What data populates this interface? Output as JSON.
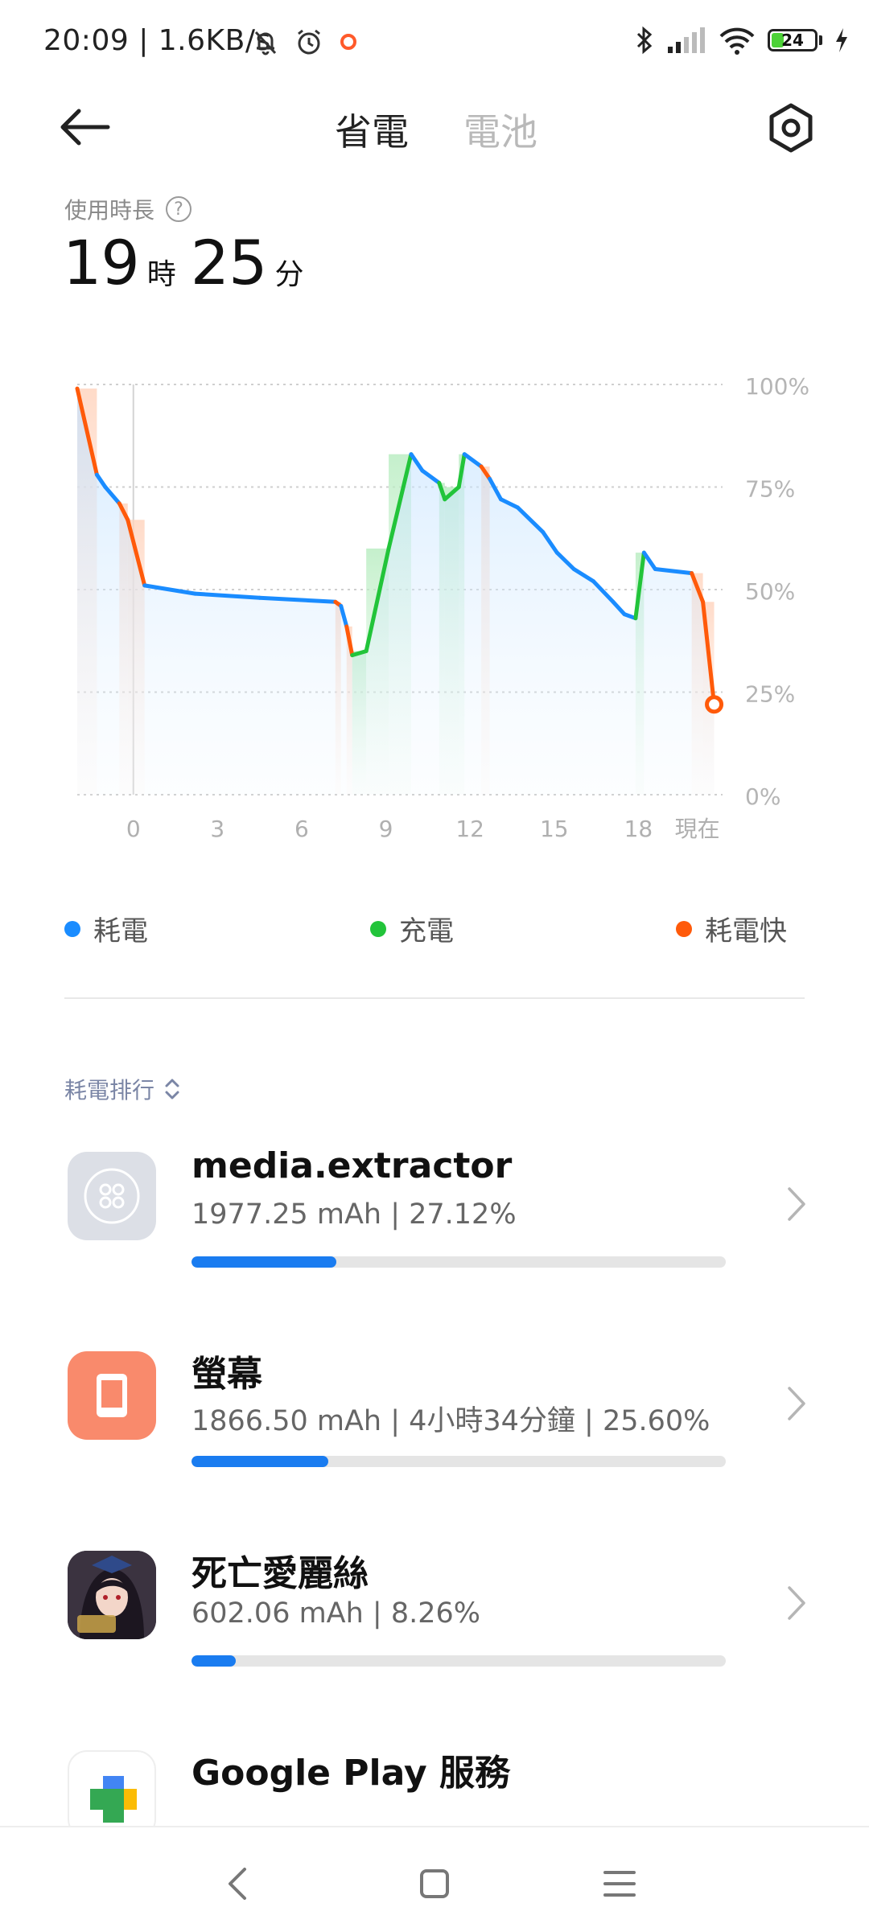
{
  "status_bar": {
    "time": "20:09 | 1.6KB/s",
    "battery_level": "24",
    "battery_color": "#4cd137"
  },
  "header": {
    "tab_power_saving": "省電",
    "tab_battery": "電池"
  },
  "usage": {
    "label": "使用時長",
    "hours": "19",
    "hours_unit": "時",
    "minutes": "25",
    "minutes_unit": "分"
  },
  "chart_data": {
    "type": "line",
    "y_ticks": [
      "100%",
      "75%",
      "50%",
      "25%",
      "0%"
    ],
    "x_ticks": [
      "0",
      "3",
      "6",
      "9",
      "12",
      "15",
      "18",
      "現在"
    ],
    "ylim": [
      0,
      100
    ],
    "xlim": [
      -2,
      21
    ],
    "points": [
      {
        "x": -2.0,
        "y": 99,
        "s": "fast"
      },
      {
        "x": -1.3,
        "y": 78,
        "s": "normal"
      },
      {
        "x": -1.0,
        "y": 75,
        "s": "normal"
      },
      {
        "x": -0.5,
        "y": 71,
        "s": "fast"
      },
      {
        "x": -0.2,
        "y": 67,
        "s": "fast"
      },
      {
        "x": 0.4,
        "y": 51,
        "s": "normal"
      },
      {
        "x": 2.2,
        "y": 49,
        "s": "normal"
      },
      {
        "x": 4.5,
        "y": 48,
        "s": "normal"
      },
      {
        "x": 7.2,
        "y": 47,
        "s": "fast"
      },
      {
        "x": 7.4,
        "y": 46,
        "s": "normal"
      },
      {
        "x": 7.6,
        "y": 41,
        "s": "fast"
      },
      {
        "x": 7.8,
        "y": 34,
        "s": "charging"
      },
      {
        "x": 8.3,
        "y": 35,
        "s": "charging"
      },
      {
        "x": 9.1,
        "y": 60,
        "s": "charging"
      },
      {
        "x": 9.9,
        "y": 83,
        "s": "normal"
      },
      {
        "x": 10.3,
        "y": 79,
        "s": "normal"
      },
      {
        "x": 10.9,
        "y": 76,
        "s": "charging"
      },
      {
        "x": 11.1,
        "y": 72,
        "s": "charging"
      },
      {
        "x": 11.6,
        "y": 75,
        "s": "charging"
      },
      {
        "x": 11.8,
        "y": 83,
        "s": "normal"
      },
      {
        "x": 12.4,
        "y": 80,
        "s": "fast"
      },
      {
        "x": 12.7,
        "y": 77,
        "s": "normal"
      },
      {
        "x": 13.1,
        "y": 72,
        "s": "normal"
      },
      {
        "x": 13.7,
        "y": 70,
        "s": "normal"
      },
      {
        "x": 14.6,
        "y": 64,
        "s": "normal"
      },
      {
        "x": 15.1,
        "y": 59,
        "s": "normal"
      },
      {
        "x": 15.7,
        "y": 55,
        "s": "normal"
      },
      {
        "x": 16.4,
        "y": 52,
        "s": "normal"
      },
      {
        "x": 17.1,
        "y": 47,
        "s": "normal"
      },
      {
        "x": 17.5,
        "y": 44,
        "s": "normal"
      },
      {
        "x": 17.9,
        "y": 43,
        "s": "charging"
      },
      {
        "x": 18.2,
        "y": 59,
        "s": "normal"
      },
      {
        "x": 18.6,
        "y": 55,
        "s": "normal"
      },
      {
        "x": 19.9,
        "y": 54,
        "s": "fast"
      },
      {
        "x": 20.3,
        "y": 47,
        "s": "fast"
      },
      {
        "x": 20.7,
        "y": 22,
        "s": "fast"
      }
    ],
    "colors": {
      "normal": "#1a8cff",
      "charging": "#22c43a",
      "fast": "#ff5a0a"
    }
  },
  "legend": [
    {
      "label": "耗電",
      "color": "#1a8cff"
    },
    {
      "label": "充電",
      "color": "#22c43a"
    },
    {
      "label": "耗電快",
      "color": "#ff5a0a"
    }
  ],
  "ranking": {
    "label": "耗電排行"
  },
  "apps": [
    {
      "name": "media.extractor",
      "detail": "1977.25 mAh | 27.12%",
      "percent": 27.12,
      "icon": "system-app-icon"
    },
    {
      "name": "螢幕",
      "detail": "1866.50 mAh | 4小時34分鐘 | 25.60%",
      "percent": 25.6,
      "icon": "screen-icon"
    },
    {
      "name": "死亡愛麗絲",
      "detail": "602.06 mAh | 8.26%",
      "percent": 8.26,
      "icon": "game-icon"
    },
    {
      "name": "Google Play 服務",
      "detail": "",
      "percent": 0,
      "icon": "google-play-services-icon"
    }
  ]
}
